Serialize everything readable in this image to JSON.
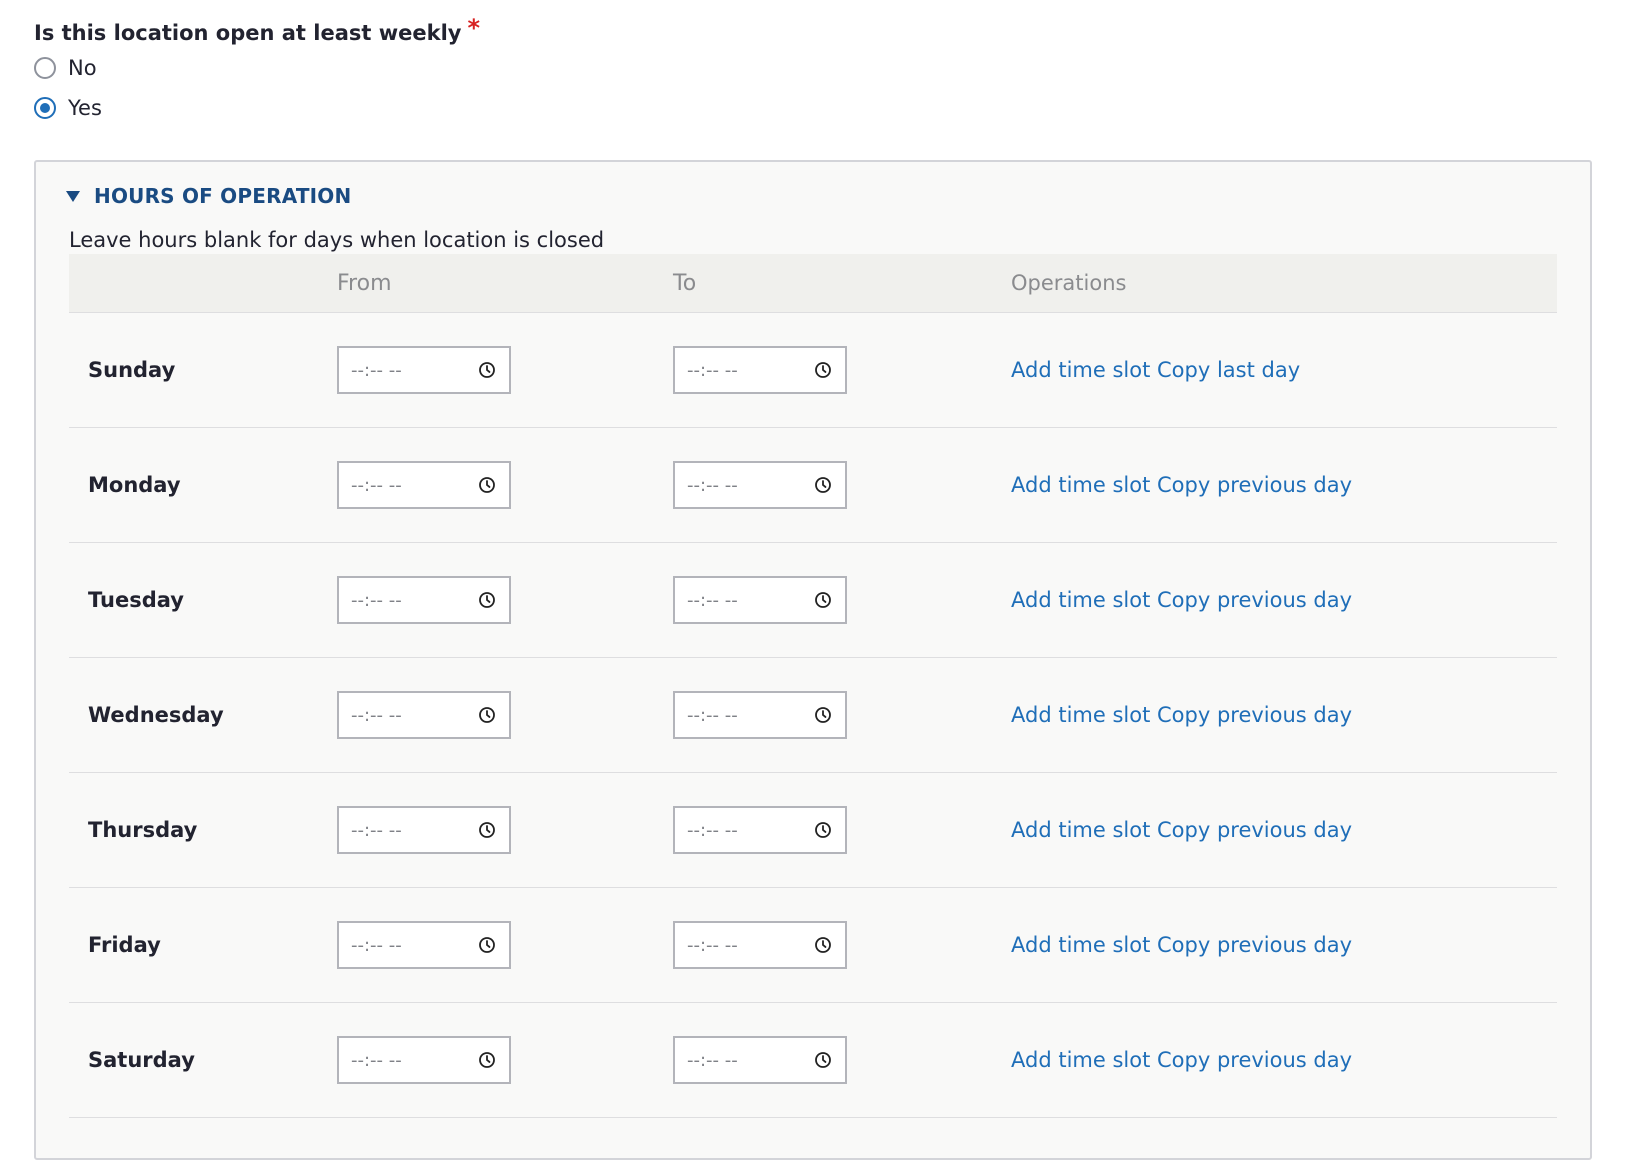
{
  "question": {
    "label": "Is this location open at least weekly",
    "required_marker": "*"
  },
  "radio_options": [
    {
      "label": "No",
      "checked": false
    },
    {
      "label": "Yes",
      "checked": true
    }
  ],
  "hours": {
    "title": "HOURS OF OPERATION",
    "help": "Leave hours blank for days when location is closed",
    "columns": {
      "day": "",
      "from": "From",
      "to": "To",
      "operations": "Operations"
    },
    "time_placeholder": "--:-- --",
    "add_label": "Add time slot",
    "rows": [
      {
        "day": "Sunday",
        "copy_label": "Copy last day"
      },
      {
        "day": "Monday",
        "copy_label": "Copy previous day"
      },
      {
        "day": "Tuesday",
        "copy_label": "Copy previous day"
      },
      {
        "day": "Wednesday",
        "copy_label": "Copy previous day"
      },
      {
        "day": "Thursday",
        "copy_label": "Copy previous day"
      },
      {
        "day": "Friday",
        "copy_label": "Copy previous day"
      },
      {
        "day": "Saturday",
        "copy_label": "Copy previous day"
      }
    ]
  },
  "colors": {
    "link": "#1f6eb8",
    "heading": "#1a4b82",
    "required": "#d72222"
  },
  "icons": {
    "clock": "clock-icon",
    "collapse": "triangle-down-icon"
  }
}
